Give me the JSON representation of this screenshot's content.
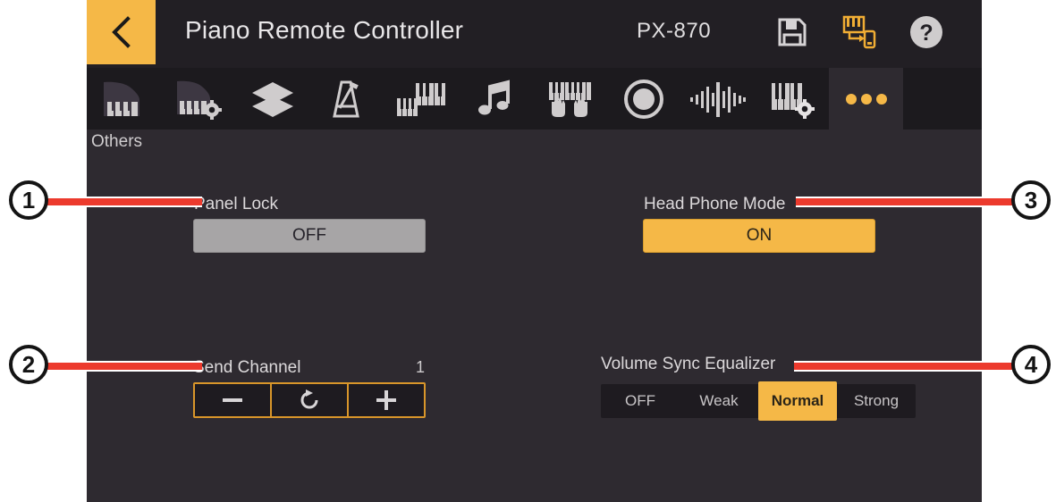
{
  "header": {
    "title": "Piano Remote Controller",
    "model": "PX-870",
    "back_icon": "chevron-left-icon",
    "save_icon": "floppy-disk-save-icon",
    "transfer_icon": "piano-to-device-transfer-icon",
    "help_icon": "question-mark-help-icon"
  },
  "tabs": [
    {
      "id": "grand-piano",
      "icon": "grand-piano-icon",
      "selected": false
    },
    {
      "id": "piano-settings",
      "icon": "grand-piano-gear-icon",
      "selected": false
    },
    {
      "id": "layer",
      "icon": "layers-icon",
      "selected": false
    },
    {
      "id": "metronome",
      "icon": "metronome-icon",
      "selected": false
    },
    {
      "id": "split",
      "icon": "split-keyboard-icon",
      "selected": false
    },
    {
      "id": "music",
      "icon": "music-note-icon",
      "selected": false
    },
    {
      "id": "duet",
      "icon": "duet-hands-keyboard-icon",
      "selected": false
    },
    {
      "id": "recorder",
      "icon": "record-circle-icon",
      "selected": false
    },
    {
      "id": "effects",
      "icon": "audio-waveform-icon",
      "selected": false
    },
    {
      "id": "keyboard-setting",
      "icon": "keyboard-gear-icon",
      "selected": false
    },
    {
      "id": "others",
      "icon": "more-dots-icon",
      "selected": true
    }
  ],
  "section": {
    "label": "Others"
  },
  "controls": {
    "panel_lock": {
      "label": "Panel Lock",
      "value": "OFF",
      "state": "off"
    },
    "head_phone_mode": {
      "label": "Head Phone Mode",
      "value": "ON",
      "state": "on"
    },
    "send_channel": {
      "label": "Send Channel",
      "value": "1",
      "decrement_icon": "minus-icon",
      "reset_icon": "reset-refresh-icon",
      "increment_icon": "plus-icon"
    },
    "volume_sync_equalizer": {
      "label": "Volume Sync Equalizer",
      "options": [
        "OFF",
        "Weak",
        "Normal",
        "Strong"
      ],
      "selected": "Normal"
    }
  },
  "callouts": [
    {
      "number": "1",
      "target": "panel-lock"
    },
    {
      "number": "2",
      "target": "send-channel"
    },
    {
      "number": "3",
      "target": "head-phone-mode"
    },
    {
      "number": "4",
      "target": "volume-sync-equalizer"
    }
  ],
  "colors": {
    "accent": "#f5b847",
    "panel_bg": "#2e2a30",
    "header_bg": "#221f24",
    "tabbar_bg": "#1c1a1e",
    "callout_line": "#ec3a2d",
    "stepper_border": "#d9962a",
    "off_button": "#a7a5a6"
  }
}
